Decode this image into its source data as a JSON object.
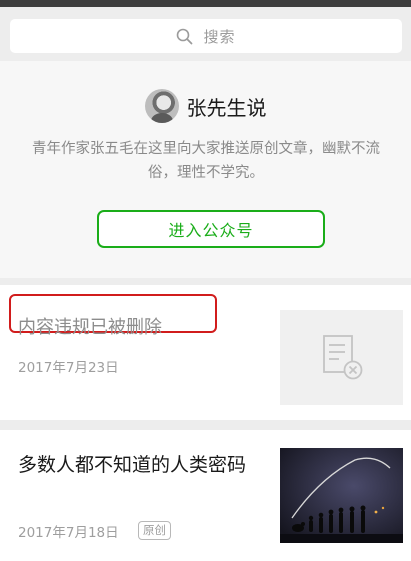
{
  "search": {
    "placeholder": "搜索"
  },
  "profile": {
    "name": "张先生说",
    "description": "青年作家张五毛在这里向大家推送原创文章，幽默不流俗，理性不学究。",
    "enter_label": "进入公众号"
  },
  "articles": [
    {
      "title": "内容违规已被删除",
      "date": "2017年7月23日",
      "deleted": true,
      "highlight_color": "#d11c1c"
    },
    {
      "title": "多数人都不知道的人类密码",
      "date": "2017年7月18日",
      "badge": "原创"
    }
  ],
  "colors": {
    "accent": "#1aad19",
    "background": "#ededed"
  }
}
